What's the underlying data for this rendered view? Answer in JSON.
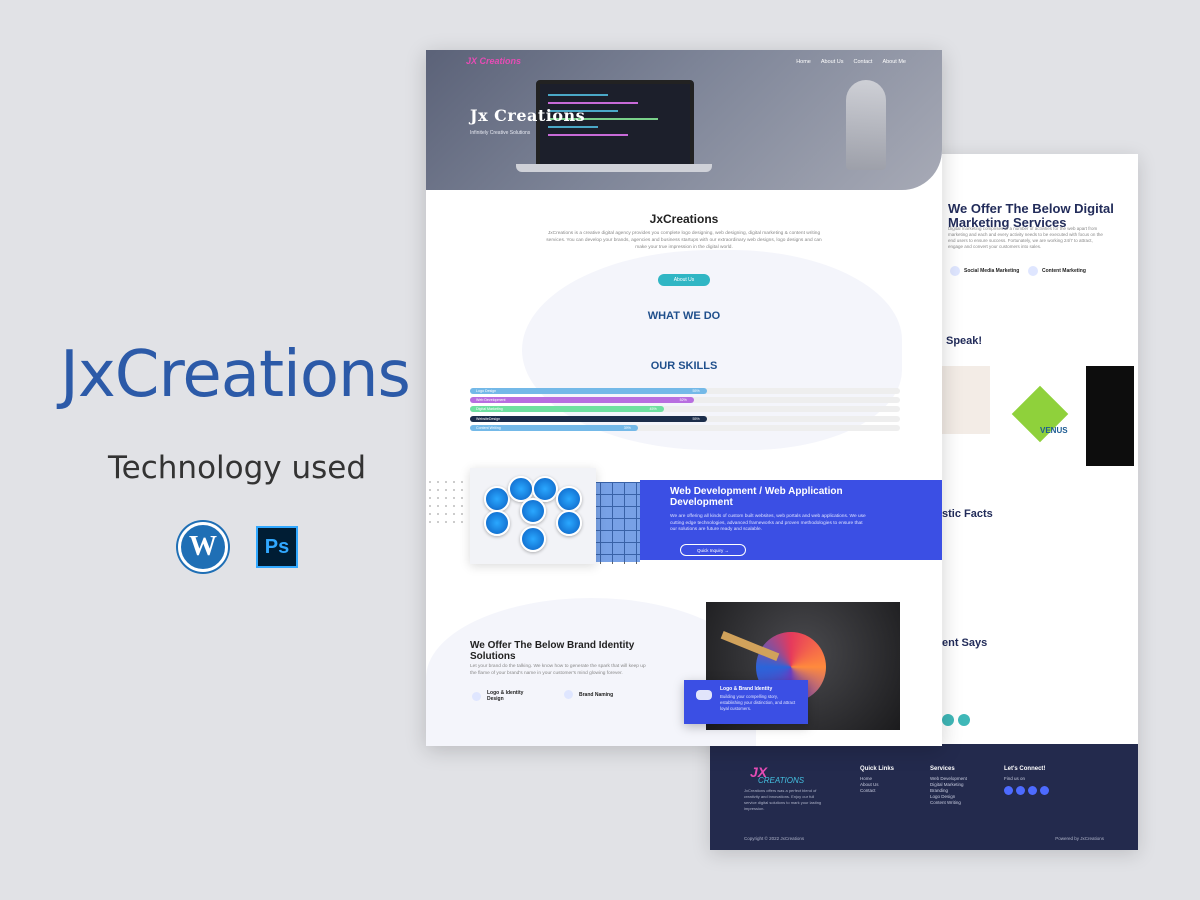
{
  "showcase": {
    "title": "JxCreations",
    "subtitle": "Technology used",
    "tech": [
      {
        "name": "wordpress-icon",
        "glyph": "W"
      },
      {
        "name": "photoshop-icon",
        "glyph": "Ps"
      }
    ]
  },
  "front": {
    "logo_text": "JX Creations",
    "nav": [
      "Home",
      "About Us",
      "Contact",
      "About Me"
    ],
    "hero_title": "Jx Creations",
    "hero_subtitle": "Infinitely Creative Solutions",
    "intro_title": "JxCreations",
    "intro_text": "JxCreations is a creative digital agency provides you complete logo designing, web designing, digital marketing & content writing services. You can develop your brands, agencies and business startups with our extraordinary web designs, logo designs and can make your true impression in the digital world.",
    "about_button": "About Us",
    "what_we_do": "WHAT WE DO",
    "our_skills": "OUR SKILLS",
    "skills": [
      {
        "name": "Logo Design",
        "percent": 55,
        "pct_label": "55%",
        "color": "#74b9e8"
      },
      {
        "name": "Web Development",
        "percent": 52,
        "pct_label": "52%",
        "color": "#b86ee0"
      },
      {
        "name": "Digital Marketing",
        "percent": 45,
        "pct_label": "45%",
        "color": "#6fe0a0"
      },
      {
        "name": "WebsiteDesign",
        "percent": 55,
        "pct_label": "55%",
        "color": "#1b2d4a"
      },
      {
        "name": "Content Writing",
        "percent": 39,
        "pct_label": "39%",
        "color": "#74b9e8"
      }
    ],
    "webdev_title": "Web Development / Web Application Development",
    "webdev_text": "We are offering all kinds of custom built websites, web portals and web applications. We use cutting edge technologies, advanced frameworks and proven methodologies to ensure that our solutions are future ready and scalable.",
    "quick_inquiry": "Quick Inquiry",
    "brand_title": "We Offer The Below Brand Identity Solutions",
    "brand_text": "Let your brand do the talking. We know how to generate the spark that will keep up the flame of your brand's name in your customer's mind glowing forever.",
    "brand_items": [
      "Logo & Identity Design",
      "Brand Naming"
    ],
    "logo_card_title": "Logo & Brand Identity",
    "logo_card_text": "Building your compelling story, establishing your distinction, and attract loyal customers."
  },
  "back": {
    "digital_title": "We Offer The Below Digital Marketing Services",
    "digital_text": "Digital marketing comprises of a number of activities for the web apart from marketing and each and every activity needs to be executed with focus on the end users to ensure success. Fortunately, we are working 24/7 to attract, engage and convert your customers into sales.",
    "digital_items": [
      "Social Media Marketing",
      "Content Marketing"
    ],
    "frag_speak": "Speak!",
    "frag_facts": "stic Facts",
    "frag_says": "ent Says",
    "client_text": "VENUS",
    "footer": {
      "logo": "JX",
      "logo_sub": "CREATIONS",
      "desc": "JxCreations offers was a perfect blend of creativity and innovations. Enjoy our full service digital solutions to mark your lasting impression.",
      "quick_links_title": "Quick Links",
      "quick_links": [
        "Home",
        "About Us",
        "Contact"
      ],
      "services_title": "Services",
      "services": [
        "Web Development",
        "Digital Marketing",
        "Branding",
        "Logo Design",
        "Content Writing"
      ],
      "connect_title": "Let's Connect!",
      "connect_text": "Find us on",
      "copyright": "Copyright © 2022 JxCreations",
      "powered": "Powered by JxCreations"
    }
  },
  "colors": {
    "brand_blue": "#2c5aa8",
    "accent_blue": "#3b4fe4",
    "teal": "#30b6c4",
    "footer_bg": "#232a4d"
  }
}
